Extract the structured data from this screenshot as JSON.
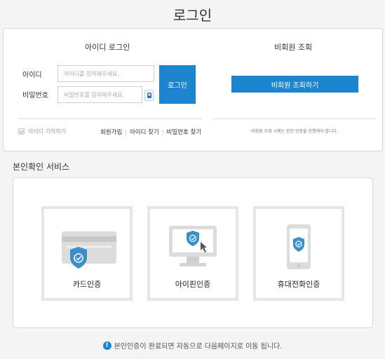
{
  "page": {
    "title": "로그인"
  },
  "member_login": {
    "title": "아이디 로그인",
    "id_label": "아이디",
    "id_placeholder": "아이디를 입력해주세요.",
    "pw_label": "비밀번호",
    "pw_placeholder": "비밀번호를 입력해주세요.",
    "login_button": "로그인",
    "remember_label": "아이디 기억하기",
    "links": [
      "회원가입",
      "아이디 찾기",
      "비밀번호 찾기"
    ]
  },
  "guest": {
    "title": "비회원 조회",
    "button": "비회원 조회하기",
    "note": "비회원 조회 시에는 본인 인증을 진행해야 합니다."
  },
  "verification": {
    "title": "본인확인 서비스",
    "options": [
      {
        "label": "카드인증",
        "icon": "credit-card-shield-icon"
      },
      {
        "label": "아이핀인증",
        "icon": "monitor-shield-icon"
      },
      {
        "label": "휴대전화인증",
        "icon": "mobile-shield-icon"
      }
    ],
    "notice": "본인인증이 완료되면 자동으로 다음페이지로 이동 됩니다."
  },
  "colors": {
    "accent": "#1d85cf",
    "shield": "#3a8fc9",
    "illustration_gray": "#d9d9d9"
  }
}
